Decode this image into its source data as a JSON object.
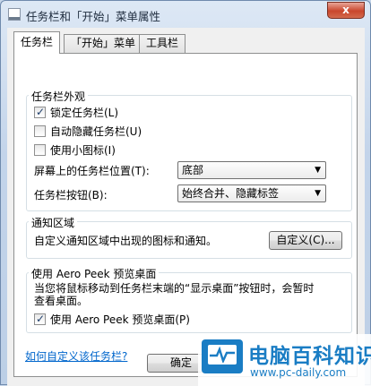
{
  "window": {
    "title": "任务栏和「开始」菜单属性",
    "close_label": "x"
  },
  "tabs": [
    {
      "label": "任务栏",
      "active": true
    },
    {
      "label": "「开始」菜单",
      "active": false
    },
    {
      "label": "工具栏",
      "active": false
    }
  ],
  "appearance": {
    "legend": "任务栏外观",
    "lock": {
      "label": "锁定任务栏(L)",
      "checked": true
    },
    "autohide": {
      "label": "自动隐藏任务栏(U)",
      "checked": false
    },
    "small_icons": {
      "label": "使用小图标(I)",
      "checked": false
    },
    "location_label": "屏幕上的任务栏位置(T):",
    "location_value": "底部",
    "buttons_label": "任务栏按钮(B):",
    "buttons_value": "始终合并、隐藏标签"
  },
  "notification": {
    "legend": "通知区域",
    "description": "自定义通知区域中出现的图标和通知。",
    "customize_label": "自定义(C)..."
  },
  "aero_peek": {
    "legend": "使用 Aero Peek 预览桌面",
    "description_line1": "当您将鼠标移动到任务栏末端的“显示桌面”按钮时，会暂时",
    "description_line2": "查看桌面。",
    "checkbox": {
      "label": "使用 Aero Peek 预览桌面(P)",
      "checked": true
    }
  },
  "help_link": "如何自定义该任务栏?",
  "footer": {
    "ok_label": "确定"
  },
  "watermark": {
    "title": "电脑百科知识",
    "url": "www.pc-daily.com"
  }
}
